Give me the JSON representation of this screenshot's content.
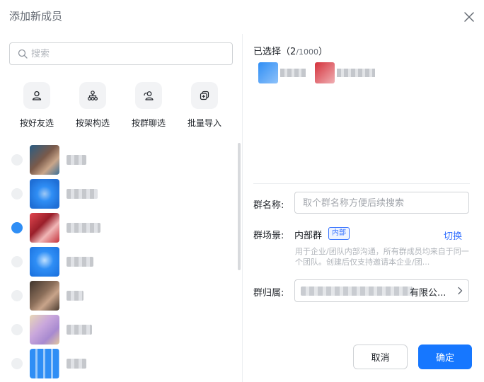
{
  "dialog": {
    "title": "添加新成员"
  },
  "search": {
    "placeholder": "搜索"
  },
  "quick_actions": [
    {
      "label": "按好友选",
      "icon": "user-icon"
    },
    {
      "label": "按架构选",
      "icon": "org-structure-icon"
    },
    {
      "label": "按群聊选",
      "icon": "group-chat-icon"
    },
    {
      "label": "批量导入",
      "icon": "batch-import-icon"
    }
  ],
  "contacts": [
    {
      "name": "",
      "avatar_color": "#4a6d8c"
    },
    {
      "name": "",
      "avatar_color": "#2f8ef5"
    },
    {
      "name": "",
      "avatar_color": "#d4313b"
    },
    {
      "name": "",
      "avatar_color": "#2f8ef5"
    },
    {
      "name": "",
      "avatar_color": "#6b5748"
    },
    {
      "name": "",
      "avatar_color": "#c9a7dc"
    },
    {
      "name": "",
      "avatar_color": "#2f8ef5"
    }
  ],
  "selected": {
    "label": "已选择",
    "open_paren": "（",
    "count": "2",
    "total": "/1000",
    "close_paren": "）",
    "chips": [
      {
        "name": "",
        "avatar_color": "#2f8ef5"
      },
      {
        "name": "",
        "avatar_color": "#d4313b"
      }
    ]
  },
  "form": {
    "group_name_label": "群名称:",
    "group_name_placeholder": "取个群名称方便后续搜索",
    "group_scene_label": "群场景:",
    "group_scene_value": "内部群",
    "group_scene_tag": "内部",
    "switch_label": "切换",
    "scene_description": "用于企业/团队内部沟通，所有群成员均来自于同一个团队。创建后仅支持邀请本企业/团...",
    "group_owner_label": "群归属:",
    "group_owner_value": "有限公..."
  },
  "buttons": {
    "cancel": "取消",
    "confirm": "确定"
  },
  "colors": {
    "accent": "#1677ff",
    "link": "#3370ff"
  }
}
